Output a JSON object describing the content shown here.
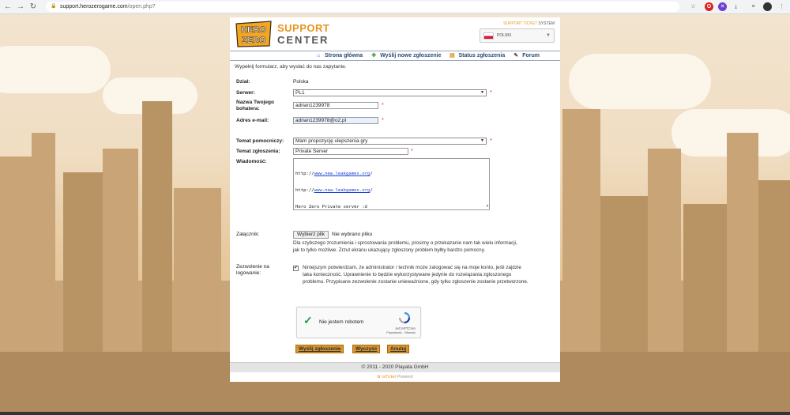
{
  "browser": {
    "url_host": "support.herozerogame.com",
    "url_path": "/open.php?",
    "back_icon": "back-arrow-icon",
    "forward_icon": "forward-arrow-icon",
    "reload_icon": "reload-icon"
  },
  "header": {
    "logo_text_top": "HERO",
    "logo_text_bottom": "ZERO",
    "support": "SUPPORT",
    "center": "CENTER",
    "ticket_system_accent": "SUPPORT TICKET",
    "ticket_system_rest": " SYSTEM",
    "language": "POLSKI"
  },
  "nav": {
    "home": "Strona główna",
    "new_ticket": "Wyślij nowe zgłoszenie",
    "status": "Status zgłoszenia",
    "forum": "Forum"
  },
  "intro": "Wypełnij formularz, aby wysłać do nas zapytanie.",
  "form": {
    "department_label": "Dział:",
    "department_value": "Polska",
    "server_label": "Serwer:",
    "server_value": "PL1",
    "hero_name_label": "Nazwa Twojego bohatera:",
    "hero_name_value": "adrian1239978",
    "email_label": "Adres e-mail:",
    "email_value": "adrian1239978@o2.pl",
    "help_topic_label": "Temat pomocniczy:",
    "help_topic_value": "Mam propozycję ulepszenia gry",
    "subject_label": "Temat zgłoszenia:",
    "subject_value": "Private Server",
    "message_label": "Wiadomość:",
    "message_lines": [
      {
        "prefix": "http://",
        "link": "www.new.leakgames.org",
        "suffix": "/"
      },
      {
        "prefix": "http://",
        "link": "www.new.leakgames.org",
        "suffix": "/"
      },
      {
        "prefix": "Hero Zero Private server :d",
        "link": "",
        "suffix": ""
      }
    ],
    "attachment_label": "Załącznik:",
    "file_button": "Wybierz plik",
    "file_none": "Nie wybrano pliku",
    "attachment_help": "Dla szybszego zrozumienia i sprostowania problemu, prosimy o przekazanie nam tak wielu informacji, jak to tylko możliwe. Zrzut ekranu ukazujący zgłoszony problem byłby bardzo pomocny.",
    "permission_label": "Zezwolenie na logowanie:",
    "permission_text": "Niniejszym potwierdzam, że administrator / technik może zalogować się na moje konto, jeśli zajdzie taka konieczność. Uprawnienie to będzie wykorzystywane jedynie do rozwiązania zgłoszonego problemu. Przypisane zezwolenie zostanie unieważnione, gdy tylko zgłoszenie zostanie przetworzone.",
    "required_mark": "*"
  },
  "captcha": {
    "label": "Nie jestem robotem",
    "brand": "reCAPTCHA",
    "links": "Prywatność - Warunki"
  },
  "buttons": {
    "submit": "Wyślij zgłoszenie",
    "reset": "Wyczyść",
    "cancel": "Anuluj"
  },
  "footer": {
    "copyright": "© 2011 - 2020 Playata GmbH",
    "powered_brand": "osTicket",
    "powered_suffix": " Powered"
  },
  "colors": {
    "accent_orange": "#e8951e",
    "nav_blue": "#2b4a7a",
    "button_orange": "#d9962c"
  }
}
